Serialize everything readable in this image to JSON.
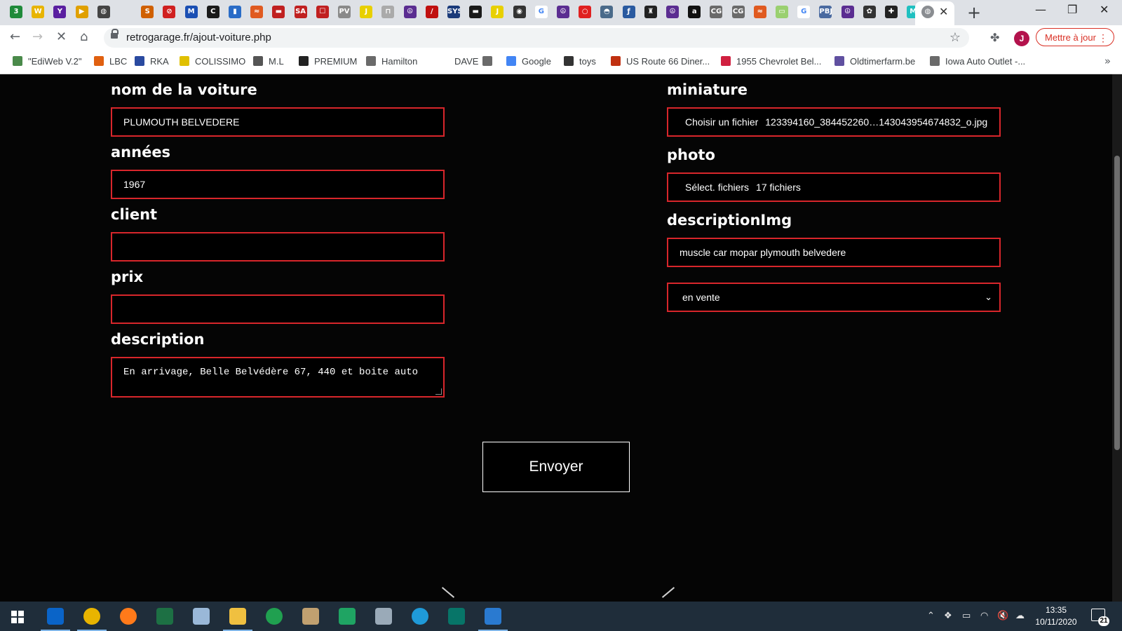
{
  "browser": {
    "url": "retrogarage.fr/ajout-voiture.php",
    "update_label": "Mettre à jour",
    "avatar_letter": "J",
    "tab_favicons": [
      {
        "letter": "3",
        "color": "#1f8a3a"
      },
      {
        "letter": "W",
        "color": "#e8b400"
      },
      {
        "letter": "Y",
        "color": "#5a1fa0"
      },
      {
        "letter": "▶",
        "color": "#e0a000"
      },
      {
        "letter": "◍",
        "color": "#444444"
      },
      {
        "letter": "",
        "color": "#dee1e6"
      },
      {
        "letter": "S",
        "color": "#d06000"
      },
      {
        "letter": "⊘",
        "color": "#d02020"
      },
      {
        "letter": "M",
        "color": "#1b4fb3"
      },
      {
        "letter": "C",
        "color": "#1a1a1a"
      },
      {
        "letter": "▮",
        "color": "#2a6cc7"
      },
      {
        "letter": "≈",
        "color": "#e05a20"
      },
      {
        "letter": "▬",
        "color": "#c02020"
      },
      {
        "letter": "SA",
        "color": "#c02020"
      },
      {
        "letter": "☐",
        "color": "#c02020"
      },
      {
        "letter": "PV",
        "color": "#8a8a8a"
      },
      {
        "letter": "J",
        "color": "#e8d000"
      },
      {
        "letter": "⊓",
        "color": "#aaaaaa"
      },
      {
        "letter": "☮",
        "color": "#5b2d91"
      },
      {
        "letter": "/",
        "color": "#c01010"
      },
      {
        "letter": "SYS",
        "color": "#1a3a7a"
      },
      {
        "letter": "▬",
        "color": "#1a1a1a"
      },
      {
        "letter": "J",
        "color": "#e8d000"
      },
      {
        "letter": "◉",
        "color": "#333333"
      },
      {
        "letter": "G",
        "color": "#ffffff"
      },
      {
        "letter": "☮",
        "color": "#5b2d91"
      },
      {
        "letter": "○",
        "color": "#e02020"
      },
      {
        "letter": "◓",
        "color": "#4a6a8a"
      },
      {
        "letter": "ƒ",
        "color": "#2a5aa0"
      },
      {
        "letter": "♜",
        "color": "#222222"
      },
      {
        "letter": "☮",
        "color": "#5b2d91"
      },
      {
        "letter": "a",
        "color": "#111111"
      },
      {
        "letter": "CG",
        "color": "#6a6a6a"
      },
      {
        "letter": "CG",
        "color": "#6a6a6a"
      },
      {
        "letter": "≈",
        "color": "#e05a20"
      },
      {
        "letter": "▭",
        "color": "#9ad070"
      },
      {
        "letter": "G",
        "color": "#ffffff"
      },
      {
        "letter": "PBJ",
        "color": "#4a6aa0"
      },
      {
        "letter": "☮",
        "color": "#5b2d91"
      },
      {
        "letter": "✿",
        "color": "#333333"
      },
      {
        "letter": "✚",
        "color": "#222222"
      },
      {
        "letter": "M",
        "color": "#20c0c0"
      }
    ],
    "bookmarks": [
      {
        "label": "\"EdiWeb V.2\"",
        "color": "#4a8a4a"
      },
      {
        "label": "LBC",
        "color": "#e06010"
      },
      {
        "label": "RKA",
        "color": "#2a4aa0"
      },
      {
        "label": "COLISSIMO",
        "color": "#e0c000"
      },
      {
        "label": "M.L",
        "color": "#555555"
      },
      {
        "label": "PREMIUM",
        "color": "#222222"
      },
      {
        "label": "Hamilton",
        "color": "#6a6a6a"
      },
      {
        "label": "DAVE",
        "color": "#ffffff"
      },
      {
        "label": "",
        "color": "#6a6a6a"
      },
      {
        "label": "Google",
        "color": "#4285f4"
      },
      {
        "label": "toys",
        "color": "#333333"
      },
      {
        "label": "US Route 66 Diner...",
        "color": "#c03010"
      },
      {
        "label": "1955 Chevrolet Bel...",
        "color": "#d02040"
      },
      {
        "label": "Oldtimerfarm.be",
        "color": "#6050a0"
      },
      {
        "label": "Iowa Auto Outlet -...",
        "color": "#6a6a6a"
      }
    ]
  },
  "form": {
    "nom": {
      "label": "nom de la voiture",
      "value": "PLUMOUTH BELVEDERE"
    },
    "annees": {
      "label": "années",
      "value": "1967"
    },
    "client": {
      "label": "client",
      "value": ""
    },
    "prix": {
      "label": "prix",
      "value": ""
    },
    "description": {
      "label": "description",
      "value": "En arrivage, Belle Belvédère 67, 440 et boite auto"
    },
    "miniature": {
      "label": "miniature",
      "button": "Choisir un fichier",
      "filename": "123394160_384452260…143043954674832_o.jpg"
    },
    "photo": {
      "label": "photo",
      "button": "Sélect. fichiers",
      "filename": "17 fichiers"
    },
    "descriptionImg": {
      "label": "descriptionImg",
      "value": "muscle car  mopar plymouth belvedere"
    },
    "status": {
      "selected": "en vente"
    },
    "submit_label": "Envoyer",
    "border_color": "#d8262b"
  },
  "taskbar": {
    "time": "13:35",
    "date": "10/11/2020",
    "notifications": "21",
    "apps": [
      {
        "name": "outlook",
        "color": "#0a64c8"
      },
      {
        "name": "chrome",
        "color": "#e8b400"
      },
      {
        "name": "firefox",
        "color": "#ff7a1a"
      },
      {
        "name": "excel",
        "color": "#1d7044"
      },
      {
        "name": "notes",
        "color": "#9ab8d8"
      },
      {
        "name": "explorer",
        "color": "#f0c040"
      },
      {
        "name": "app-green",
        "color": "#20a050"
      },
      {
        "name": "people",
        "color": "#c0a070"
      },
      {
        "name": "drive",
        "color": "#1fa463"
      },
      {
        "name": "cloud",
        "color": "#9aaab8"
      },
      {
        "name": "edge",
        "color": "#1f9ad8"
      },
      {
        "name": "publisher",
        "color": "#077568"
      },
      {
        "name": "photos",
        "color": "#2a7ad0"
      }
    ]
  }
}
